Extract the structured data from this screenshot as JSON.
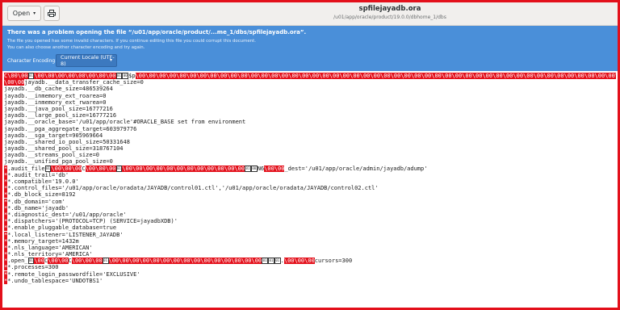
{
  "header": {
    "open_label": "Open",
    "print_icon": "print-icon",
    "title": "spfilejayadb.ora",
    "subtitle": "/u01/app/oracle/product/19.0.0/dbhome_1/dbs"
  },
  "infobar": {
    "title": "There was a problem opening the file “/u01/app/oracle/product/...me_1/dbs/spfilejayadb.ora”.",
    "line1": "The file you opened has some invalid characters. If you continue editing this file you could corrupt this document.",
    "line2": "You can also choose another character encoding and try again.",
    "encoding_label": "Character Encoding:",
    "encoding_value": "Current Locale (UTF-8)"
  },
  "lines": [
    "jayadb.__data_transfer_cache_size=0",
    "jayadb.__db_cache_size=486539264",
    "jayadb.__inmemory_ext_roarea=0",
    "jayadb.__inmemory_ext_rwarea=0",
    "jayadb.__java_pool_size=16777216",
    "jayadb.__large_pool_size=16777216",
    "jayadb.__oracle_base='/u01/app/oracle'#ORACLE_BASE set from environment",
    "jayadb.__pga_aggregate_target=603979776",
    "jayadb.__sga_target=905969664",
    "jayadb.__shared_io_pool_size=50331648",
    "jayadb.__shared_pool_size=318767104",
    "jayadb.__streams_pool_size=0",
    "jayadb.__unified_pga_pool_size=0"
  ],
  "audit_file_tail": "dest='/u01/app/oracle/admin/jayadb/adump'",
  "lines2": [
    "*.audit_trail='db'",
    "*.compatible='19.0.0'",
    "*.control_files='/u01/app/oracle/oradata/JAYADB/control01.ctl','/u01/app/oracle/oradata/JAYADB/control02.ctl'",
    "*.db_block_size=8192",
    "*.db_domain='com'",
    "*.db_name='jayadb'",
    "*.diagnostic_dest='/u01/app/oracle'",
    "*.dispatchers='(PROTOCOL=TCP) (SERVICE=jayadbXDB)'",
    "*.enable_pluggable_database=true",
    "*.local_listener='LISTENER_JAYADB'",
    "*.memory_target=1432m",
    "*.nls_language='AMERICAN'",
    "*.nls_territory='AMERICA'"
  ],
  "open_cursors_tail": "cursors=300",
  "lines3": [
    "*.processes=300",
    "*.remote_login_passwordfile='EXCLUSIVE'",
    "*.undo_tablespace='UNDOTBS1'"
  ],
  "colors": {
    "invalid_highlight": "#e3101b",
    "infobar": "#4a8fd9",
    "frame": "#e3101b"
  }
}
